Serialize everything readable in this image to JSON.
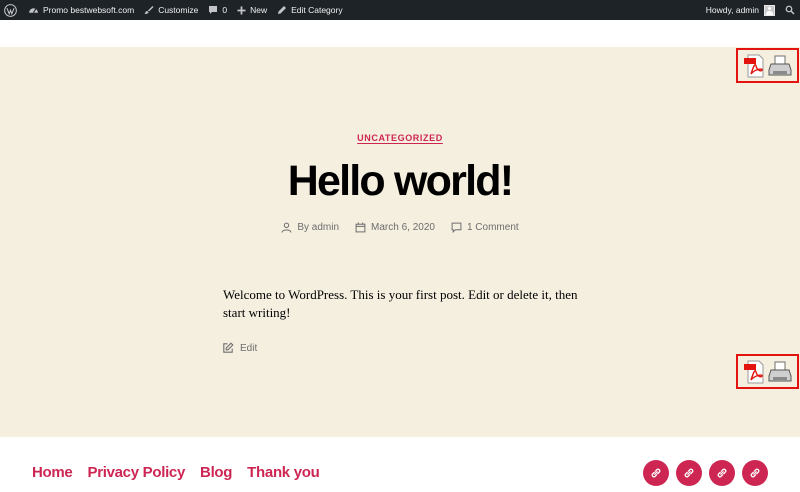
{
  "admin_bar": {
    "site_name": "Promo bestwebsoft.com",
    "customize": "Customize",
    "comments_count": "0",
    "new": "New",
    "edit_category": "Edit Category",
    "howdy": "Howdy, admin"
  },
  "post": {
    "category": "UNCATEGORIZED",
    "title": "Hello world!",
    "author": "By admin",
    "date": "March 6, 2020",
    "comments": "1 Comment",
    "content": "Welcome to WordPress. This is your first post. Edit or delete it, then start writing!",
    "edit_label": "Edit"
  },
  "pdf_print": {
    "icons": [
      "pdf-icon",
      "print-icon"
    ],
    "highlight_color": "#e3130f"
  },
  "footer": {
    "nav": [
      {
        "label": "Home"
      },
      {
        "label": "Privacy Policy"
      },
      {
        "label": "Blog"
      },
      {
        "label": "Thank you"
      }
    ],
    "social_icons": [
      "link-icon",
      "link-icon",
      "link-icon",
      "link-icon"
    ]
  },
  "colors": {
    "accent": "#cd2653",
    "admin_bar_bg": "#1d2327",
    "header_band_bg": "#f5efe0"
  }
}
